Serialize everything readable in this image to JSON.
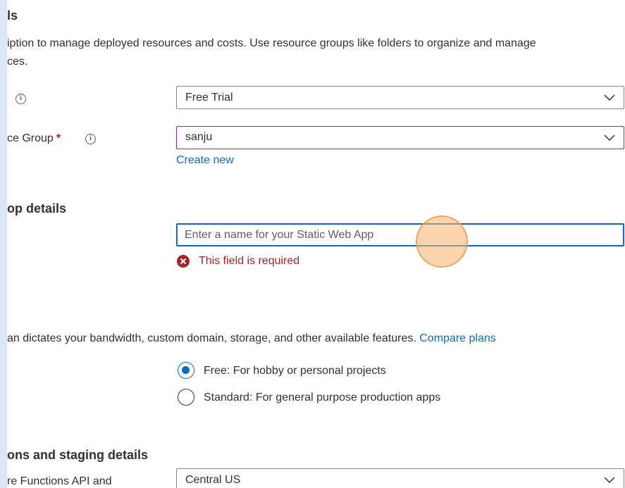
{
  "project": {
    "heading": "ls",
    "description_line1": "iption to manage deployed resources and costs. Use resource groups like folders to organize and manage",
    "description_line2": "ces."
  },
  "subscription": {
    "label": "",
    "value": "Free Trial"
  },
  "resource_group": {
    "label": "ce Group",
    "required_mark": "*",
    "value": "sanju",
    "create_new_label": "Create new"
  },
  "app_details": {
    "heading": "op details",
    "name_placeholder": "Enter a name for your Static Web App",
    "name_value": "",
    "error_message": "This field is required"
  },
  "plan": {
    "description": "an dictates your bandwidth, custom domain, storage, and other available features.",
    "compare_link": "Compare plans",
    "options": [
      {
        "label": "Free: For hobby or personal projects",
        "checked": true
      },
      {
        "label": "Standard: For general purpose production apps",
        "checked": false
      }
    ]
  },
  "functions_staging": {
    "heading": "ons and staging details",
    "region_label": "re Functions API and",
    "region_value": "Central US"
  },
  "colors": {
    "accent": "#0f6cbd",
    "error": "#a4262c",
    "focus_border": "#8b2c8f",
    "cursor_highlight": "#fab26e"
  }
}
